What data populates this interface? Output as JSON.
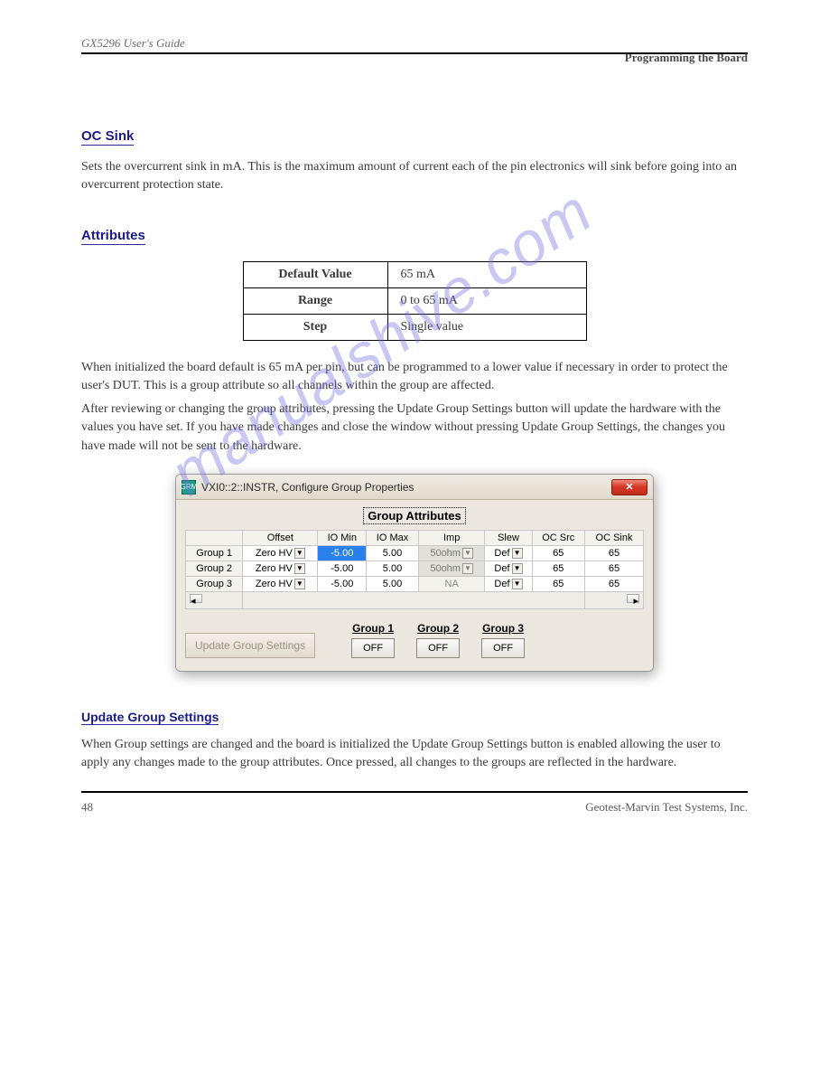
{
  "header": {
    "running_title": "GX5296 User's Guide",
    "section_right": "Programming the Board"
  },
  "watermark": "manualshive.com",
  "sections": {
    "oc_sink": {
      "title": "OC Sink",
      "text": "Sets the overcurrent sink in mA. This is the maximum amount of current each of the pin electronics will sink before going into an overcurrent protection state."
    },
    "attributes": {
      "title": "Attributes",
      "rows": [
        {
          "label": "Default Value",
          "value": "65 mA"
        },
        {
          "label": "Range",
          "value": "0 to 65 mA"
        },
        {
          "label": "Step",
          "value": "Single value"
        }
      ]
    },
    "body_default": "When initialized the board default is 65 mA per pin, but can be programmed to a lower value if necessary in order to protect the user's DUT. This is a group attribute so all channels within the group are affected.",
    "body_finish": "After reviewing or changing the group attributes, pressing the Update Group Settings button will update the hardware with the values you have set. If you have made changes and close the window without pressing Update Group Settings, the changes you have made will not be sent to the hardware.",
    "update_group": {
      "title": "Update Group Settings",
      "text": "When Group settings are changed and the board is initialized the Update Group Settings button is enabled allowing the user to apply any changes made to the group attributes. Once pressed, all changes to the groups are reflected in the hardware."
    }
  },
  "dialog": {
    "title": "VXI0::2::INSTR, Configure Group Properties",
    "panel_title": "Group Attributes",
    "close_label": "✕",
    "columns": [
      "",
      "Offset",
      "IO Min",
      "IO Max",
      "Imp",
      "Slew",
      "OC Src",
      "OC Sink"
    ],
    "rows": [
      {
        "name": "Group 1",
        "offset": "Zero HV",
        "iomin": "-5.00",
        "iomax": "5.00",
        "imp": "50ohm",
        "slew": "Def",
        "ocsrc": "65",
        "ocsink": "65",
        "imp_disabled": true,
        "iomin_selected": true
      },
      {
        "name": "Group 2",
        "offset": "Zero HV",
        "iomin": "-5.00",
        "iomax": "5.00",
        "imp": "50ohm",
        "slew": "Def",
        "ocsrc": "65",
        "ocsink": "65",
        "imp_disabled": true
      },
      {
        "name": "Group 3",
        "offset": "Zero HV",
        "iomin": "-5.00",
        "iomax": "5.00",
        "imp": "NA",
        "slew": "Def",
        "ocsrc": "65",
        "ocsink": "65",
        "imp_na": true
      }
    ],
    "update_button": "Update Group Settings",
    "toggles": [
      {
        "label": "Group 1",
        "state": "OFF"
      },
      {
        "label": "Group 2",
        "state": "OFF"
      },
      {
        "label": "Group 3",
        "state": "OFF"
      }
    ]
  },
  "footer": {
    "left": "48",
    "right": "Geotest-Marvin Test Systems, Inc."
  }
}
